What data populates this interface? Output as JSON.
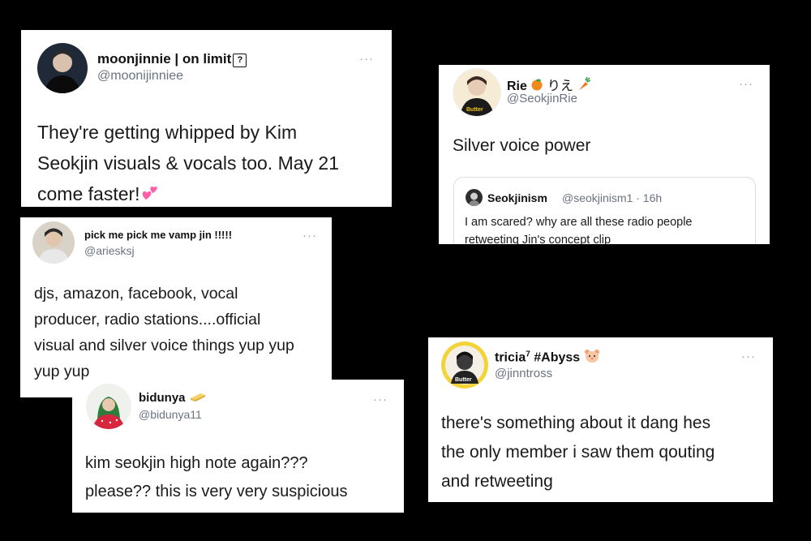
{
  "tweets": [
    {
      "name": "moonjinnie | on limit",
      "name_suffix": "?",
      "handle": "@moonijinniee",
      "lines": [
        "They're getting whipped by Kim",
        "Seokjin visuals & vocals too. May 21",
        "come faster!"
      ],
      "more": "···"
    },
    {
      "name": "Rie",
      "name_suffix": "りえ",
      "handle": "@SeokjinRie",
      "lines": [
        "Silver voice power"
      ],
      "more": "···",
      "quote": {
        "name": "Seokjinism",
        "handle": "@seokjinism1 · 16h",
        "lines": [
          "I am scared? why are all these radio people",
          "retweeting Jin's concept clip"
        ]
      }
    },
    {
      "name": "pick me pick me vamp jin !!!!!",
      "handle": "@ariesksj",
      "lines": [
        "djs, amazon, facebook, vocal",
        "producer, radio stations....official",
        "visual and silver voice things yup yup",
        "yup yup"
      ],
      "more": "···"
    },
    {
      "name": "bidunya",
      "handle": "@bidunya11",
      "lines": [
        "kim seokjin high note again???",
        "please?? this is very very suspicious"
      ],
      "more": "···"
    },
    {
      "name": "tricia",
      "name_sup": "7",
      "name_tag": "#Abyss",
      "handle": "@jinntross",
      "lines": [
        "there's something about it dang hes",
        "the only member i saw them qouting",
        "and retweeting"
      ],
      "more": "···"
    }
  ],
  "colors": {
    "background": "#000000",
    "card": "#ffffff",
    "handle": "#6b7280",
    "heart_emoji": "#ff5ea8",
    "orange_emoji": "#f08a1c",
    "carrot_emoji": "#f07a1a"
  },
  "icons": {
    "t1_emoji": "two-hearts-icon",
    "t2_emoji_1": "orange-icon",
    "t2_emoji_2": "carrot-icon",
    "t4_emoji": "butter-icon",
    "t5_emoji": "hamster-icon"
  }
}
